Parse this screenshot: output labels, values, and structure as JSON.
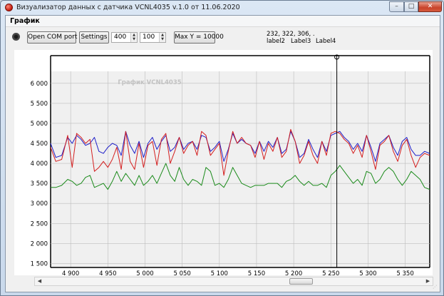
{
  "window": {
    "title": "Визуализатор данных с датчика VCNL4035 v.1.0 от 11.06.2020",
    "minimize_glyph": "–",
    "maximize_glyph": "□",
    "close_glyph": "✕"
  },
  "menu": {
    "items": [
      "График"
    ]
  },
  "toolbar": {
    "open_com_label": "Open COM port",
    "settings_label": "Settings",
    "spin1_value": "400",
    "spin2_value": "100",
    "max_y_label": "Max Y = 10000",
    "info_values": "232, 322, 306, .",
    "label2": "label2",
    "label3": "Label3",
    "label4": "Label4"
  },
  "chart_data": {
    "type": "line",
    "title": "График VCNL4035",
    "xlim": [
      4873,
      5383
    ],
    "ylim": [
      1400,
      6300
    ],
    "xticks": [
      4900,
      4950,
      5000,
      5050,
      5100,
      5150,
      5200,
      5250,
      5300,
      5350
    ],
    "xtick_labels": [
      "4 900",
      "4 950",
      "5 000",
      "5 050",
      "5 100",
      "5 150",
      "5 200",
      "5 250",
      "5 300",
      "5 350"
    ],
    "yticks": [
      1500,
      2000,
      2500,
      3000,
      3500,
      4000,
      4500,
      5000,
      5500,
      6000
    ],
    "ytick_labels": [
      "1 500",
      "2 000",
      "2 500",
      "3 000",
      "3 500",
      "4 000",
      "4 500",
      "5 000",
      "5 500",
      "6 000"
    ],
    "grid": true,
    "cursor_x": 5258,
    "series": [
      {
        "color": "#1f1fc8",
        "x": [
          4873,
          4880,
          4888,
          4896,
          4902,
          4908,
          4914,
          4920,
          4926,
          4932,
          4938,
          4944,
          4950,
          4956,
          4962,
          4968,
          4974,
          4980,
          4986,
          4992,
          4998,
          5004,
          5010,
          5016,
          5022,
          5028,
          5034,
          5040,
          5046,
          5052,
          5058,
          5064,
          5070,
          5076,
          5082,
          5088,
          5094,
          5100,
          5106,
          5112,
          5118,
          5124,
          5130,
          5136,
          5142,
          5148,
          5154,
          5160,
          5166,
          5172,
          5178,
          5184,
          5190,
          5196,
          5202,
          5208,
          5214,
          5220,
          5226,
          5232,
          5238,
          5244,
          5250,
          5256,
          5262,
          5268,
          5274,
          5280,
          5286,
          5292,
          5298,
          5304,
          5310,
          5316,
          5322,
          5328,
          5334,
          5340,
          5346,
          5352,
          5358,
          5364,
          5370,
          5376,
          5383
        ],
        "values": [
          4500,
          4150,
          4200,
          4650,
          4500,
          4700,
          4600,
          4450,
          4500,
          4650,
          4300,
          4250,
          4400,
          4500,
          4450,
          4200,
          4800,
          4450,
          4250,
          4550,
          4150,
          4500,
          4650,
          4350,
          4550,
          4700,
          4300,
          4400,
          4650,
          4350,
          4500,
          4550,
          4350,
          4700,
          4650,
          4300,
          4400,
          4550,
          4050,
          4350,
          4750,
          4500,
          4600,
          4500,
          4450,
          4250,
          4550,
          4300,
          4550,
          4400,
          4650,
          4250,
          4350,
          4800,
          4550,
          4150,
          4250,
          4600,
          4350,
          4150,
          4550,
          4300,
          4700,
          4750,
          4800,
          4650,
          4550,
          4350,
          4500,
          4300,
          4700,
          4400,
          4050,
          4500,
          4600,
          4700,
          4400,
          4200,
          4550,
          4650,
          4350,
          4200,
          4200,
          4300,
          4250
        ]
      },
      {
        "color": "#d41f1f",
        "x": [
          4873,
          4880,
          4888,
          4896,
          4902,
          4908,
          4914,
          4920,
          4926,
          4932,
          4938,
          4944,
          4950,
          4956,
          4962,
          4968,
          4974,
          4980,
          4986,
          4992,
          4998,
          5004,
          5010,
          5016,
          5022,
          5028,
          5034,
          5040,
          5046,
          5052,
          5058,
          5064,
          5070,
          5076,
          5082,
          5088,
          5094,
          5100,
          5106,
          5112,
          5118,
          5124,
          5130,
          5136,
          5142,
          5148,
          5154,
          5160,
          5166,
          5172,
          5178,
          5184,
          5190,
          5196,
          5202,
          5208,
          5214,
          5220,
          5226,
          5232,
          5238,
          5244,
          5250,
          5256,
          5262,
          5268,
          5274,
          5280,
          5286,
          5292,
          5298,
          5304,
          5310,
          5316,
          5322,
          5328,
          5334,
          5340,
          5346,
          5352,
          5358,
          5364,
          5370,
          5376,
          5383
        ],
        "values": [
          4400,
          4050,
          4100,
          4700,
          3900,
          4750,
          4650,
          4500,
          4600,
          3800,
          3900,
          4050,
          3900,
          4100,
          4400,
          3850,
          4800,
          4050,
          3850,
          4500,
          3900,
          4450,
          4550,
          3950,
          4600,
          4750,
          4000,
          4300,
          4650,
          4250,
          4450,
          4550,
          4200,
          4800,
          4700,
          4200,
          4350,
          4500,
          3700,
          4300,
          4800,
          4500,
          4650,
          4500,
          4450,
          4150,
          4550,
          4100,
          4500,
          4300,
          4650,
          4150,
          4300,
          4850,
          4550,
          4000,
          4200,
          4550,
          4200,
          4000,
          4550,
          4200,
          4750,
          4800,
          4750,
          4600,
          4500,
          4250,
          4450,
          4150,
          4700,
          4300,
          3850,
          4450,
          4550,
          4700,
          4300,
          4050,
          4450,
          4600,
          4200,
          3900,
          4150,
          4250,
          4200
        ]
      },
      {
        "color": "#1a8a1a",
        "x": [
          4873,
          4880,
          4888,
          4896,
          4902,
          4908,
          4914,
          4920,
          4926,
          4932,
          4938,
          4944,
          4950,
          4956,
          4962,
          4968,
          4974,
          4980,
          4986,
          4992,
          4998,
          5004,
          5010,
          5016,
          5022,
          5028,
          5034,
          5040,
          5046,
          5052,
          5058,
          5064,
          5070,
          5076,
          5082,
          5088,
          5094,
          5100,
          5106,
          5112,
          5118,
          5124,
          5130,
          5136,
          5142,
          5148,
          5154,
          5160,
          5166,
          5172,
          5178,
          5184,
          5190,
          5196,
          5202,
          5208,
          5214,
          5220,
          5226,
          5232,
          5238,
          5244,
          5250,
          5256,
          5262,
          5268,
          5274,
          5280,
          5286,
          5292,
          5298,
          5304,
          5310,
          5316,
          5322,
          5328,
          5334,
          5340,
          5346,
          5352,
          5358,
          5364,
          5370,
          5376,
          5383
        ],
        "values": [
          3400,
          3400,
          3450,
          3600,
          3550,
          3450,
          3500,
          3650,
          3700,
          3400,
          3450,
          3500,
          3350,
          3550,
          3800,
          3550,
          3750,
          3600,
          3450,
          3700,
          3450,
          3550,
          3700,
          3500,
          3750,
          4000,
          3700,
          3550,
          3900,
          3600,
          3450,
          3600,
          3550,
          3450,
          3900,
          3800,
          3450,
          3500,
          3400,
          3600,
          3900,
          3700,
          3500,
          3450,
          3400,
          3450,
          3450,
          3450,
          3500,
          3500,
          3500,
          3400,
          3550,
          3600,
          3700,
          3550,
          3450,
          3550,
          3450,
          3450,
          3500,
          3400,
          3700,
          3800,
          3950,
          3800,
          3650,
          3500,
          3600,
          3450,
          3800,
          3750,
          3500,
          3600,
          3800,
          3900,
          3800,
          3600,
          3450,
          3600,
          3800,
          3700,
          3600,
          3400,
          3350
        ]
      }
    ]
  }
}
